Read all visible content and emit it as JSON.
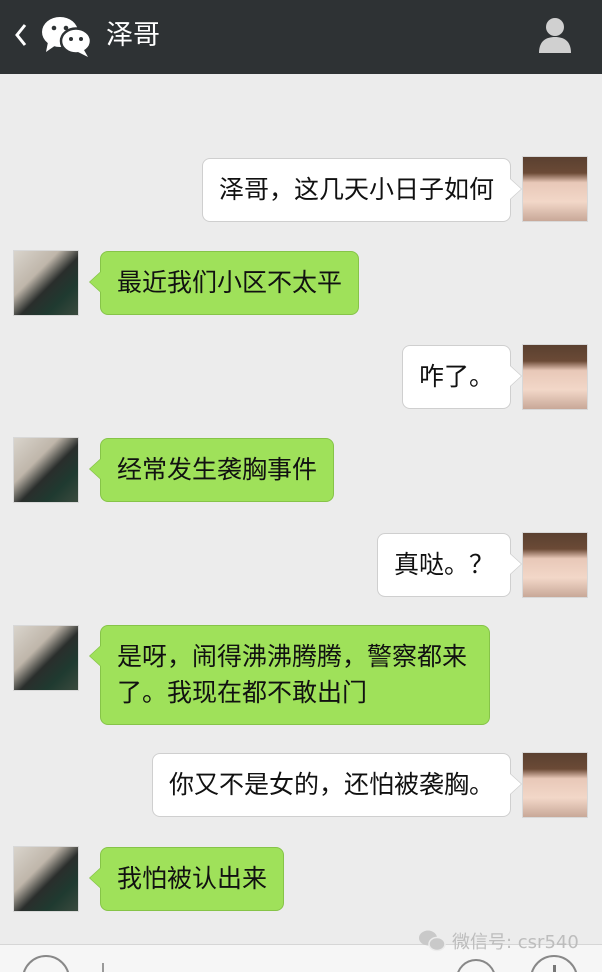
{
  "header": {
    "title": "泽哥",
    "back_icon": "chevron-left-icon",
    "app_icon": "wechat-icon",
    "profile_icon": "person-icon"
  },
  "messages": [
    {
      "side": "out",
      "text": "泽哥，这几天小日子如何"
    },
    {
      "side": "in",
      "text": "最近我们小区不太平"
    },
    {
      "side": "out",
      "text": "咋了。"
    },
    {
      "side": "in",
      "text": "经常发生袭胸事件"
    },
    {
      "side": "out",
      "text": "真哒。？"
    },
    {
      "side": "in",
      "text": "是呀，闹得沸沸腾腾，警察都来了。我现在都不敢出门"
    },
    {
      "side": "out",
      "text": "你又不是女的，还怕被袭胸。"
    },
    {
      "side": "in",
      "text": "我怕被认出来"
    }
  ],
  "watermark": {
    "text": "微信号: csr540"
  },
  "colors": {
    "header_bg": "#2e3234",
    "chat_bg": "#ececec",
    "incoming_bubble": "#9fe15a",
    "outgoing_bubble": "#ffffff"
  }
}
